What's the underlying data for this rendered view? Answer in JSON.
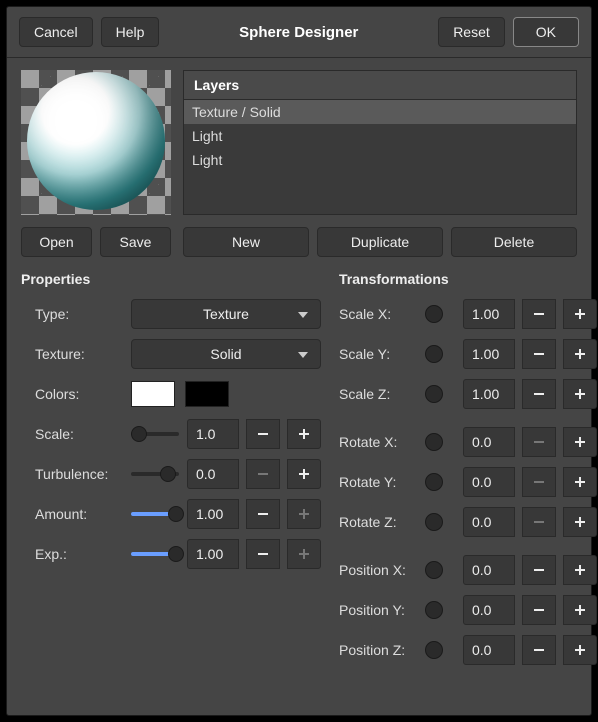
{
  "titlebar": {
    "cancel": "Cancel",
    "help": "Help",
    "title": "Sphere Designer",
    "reset": "Reset",
    "ok": "OK"
  },
  "layers": {
    "header": "Layers",
    "items": [
      "Texture / Solid",
      "Light",
      "Light"
    ],
    "selected": 0
  },
  "file_buttons": {
    "open": "Open",
    "save": "Save"
  },
  "layer_buttons": {
    "new": "New",
    "duplicate": "Duplicate",
    "delete": "Delete"
  },
  "properties": {
    "title": "Properties",
    "type_label": "Type:",
    "type_value": "Texture",
    "texture_label": "Texture:",
    "texture_value": "Solid",
    "colors_label": "Colors:",
    "color1": "#ffffff",
    "color2": "#000000",
    "scale": {
      "label": "Scale:",
      "value": "1.0",
      "minus_enabled": true,
      "plus_enabled": true,
      "slider_fill": 0,
      "thumb": 0
    },
    "turbulence": {
      "label": "Turbulence:",
      "value": "0.0",
      "minus_enabled": false,
      "plus_enabled": true,
      "slider_fill": 0,
      "thumb": 60
    },
    "amount": {
      "label": "Amount:",
      "value": "1.00",
      "minus_enabled": true,
      "plus_enabled": false,
      "slider_fill": 100,
      "thumb": 78
    },
    "exp": {
      "label": "Exp.:",
      "value": "1.00",
      "minus_enabled": true,
      "plus_enabled": false,
      "slider_fill": 100,
      "thumb": 78
    }
  },
  "transforms": {
    "title": "Transformations",
    "scalex": {
      "label": "Scale X:",
      "value": "1.00",
      "minus_enabled": true,
      "plus_enabled": true
    },
    "scaley": {
      "label": "Scale Y:",
      "value": "1.00",
      "minus_enabled": true,
      "plus_enabled": true
    },
    "scalez": {
      "label": "Scale Z:",
      "value": "1.00",
      "minus_enabled": true,
      "plus_enabled": true
    },
    "rotx": {
      "label": "Rotate X:",
      "value": "0.0",
      "minus_enabled": false,
      "plus_enabled": true
    },
    "roty": {
      "label": "Rotate Y:",
      "value": "0.0",
      "minus_enabled": false,
      "plus_enabled": true
    },
    "rotz": {
      "label": "Rotate Z:",
      "value": "0.0",
      "minus_enabled": false,
      "plus_enabled": true
    },
    "posx": {
      "label": "Position X:",
      "value": "0.0",
      "minus_enabled": true,
      "plus_enabled": true
    },
    "posy": {
      "label": "Position Y:",
      "value": "0.0",
      "minus_enabled": true,
      "plus_enabled": true
    },
    "posz": {
      "label": "Position Z:",
      "value": "0.0",
      "minus_enabled": true,
      "plus_enabled": true
    }
  }
}
